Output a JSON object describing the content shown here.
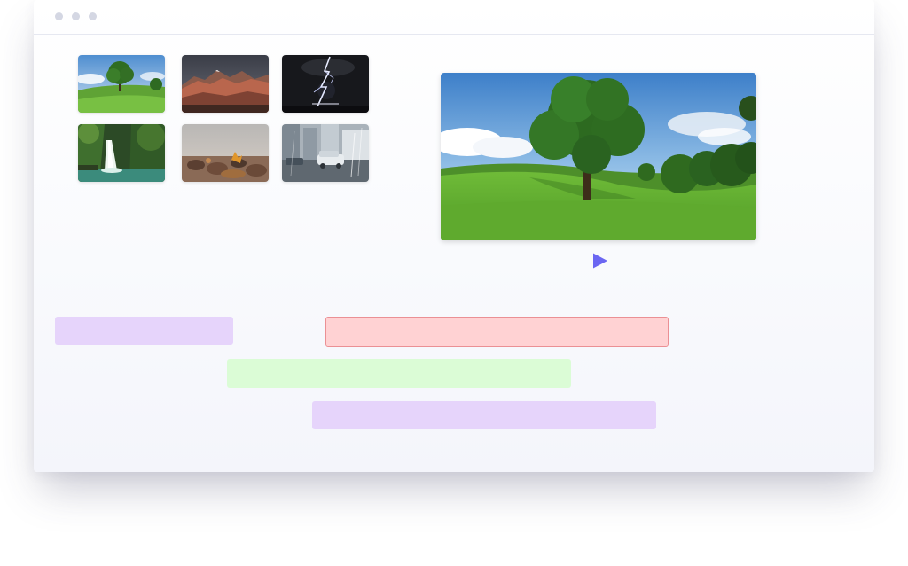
{
  "window": {
    "controls": [
      "window-dot",
      "window-dot",
      "window-dot"
    ]
  },
  "media_library": {
    "thumbnails": [
      {
        "subject": "tree-on-meadow"
      },
      {
        "subject": "mountain-range"
      },
      {
        "subject": "lightning-storm"
      },
      {
        "subject": "waterfall"
      },
      {
        "subject": "rocky-shore"
      },
      {
        "subject": "rainy-street"
      }
    ]
  },
  "preview": {
    "subject": "tree-on-meadow",
    "play_icon": "play-icon"
  },
  "timeline": {
    "clips": [
      {
        "color": "#e6d4fb"
      },
      {
        "color": "#ffd2d3",
        "border": "#eb9094",
        "selected": true
      },
      {
        "color": "#dbfcd6"
      },
      {
        "color": "#e6d4fb"
      }
    ]
  },
  "colors": {
    "accent": "#6b66f2",
    "window_background": "#f9fafd"
  }
}
